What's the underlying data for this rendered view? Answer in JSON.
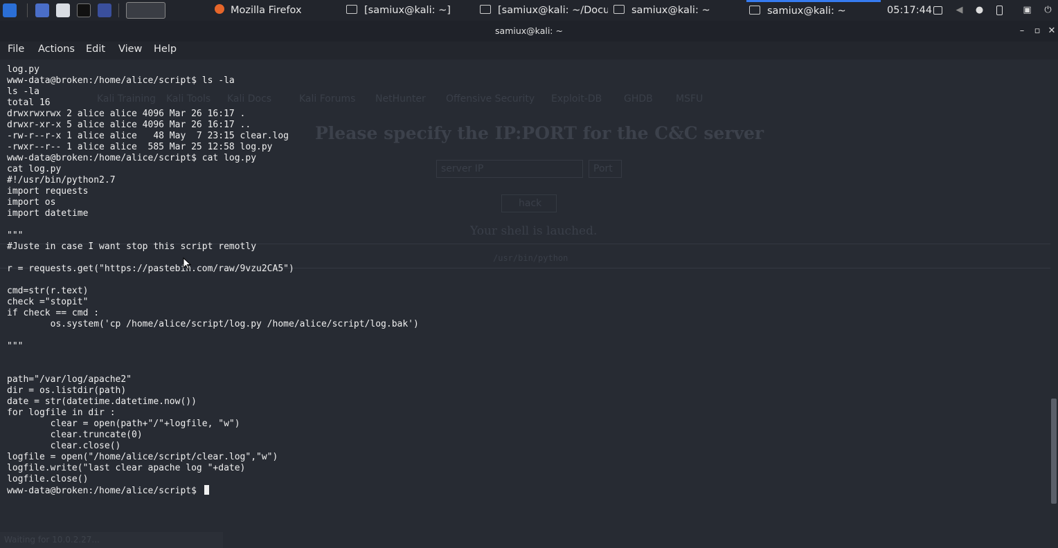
{
  "taskbar": {
    "tasks": [
      {
        "label": "Mozilla Firefox",
        "icon": "firefox-icon"
      },
      {
        "label": "[samiux@kali: ~]",
        "icon": "terminal-icon"
      },
      {
        "label": "[samiux@kali: ~/Docu...",
        "icon": "terminal-icon"
      },
      {
        "label": "samiux@kali: ~",
        "icon": "terminal-icon"
      },
      {
        "label": "samiux@kali: ~",
        "icon": "terminal-icon"
      }
    ],
    "clock": "05:17:44",
    "accent": "#367bf0"
  },
  "window": {
    "title": "samiux@kali: ~"
  },
  "menu": {
    "file": "File",
    "actions": "Actions",
    "edit": "Edit",
    "view": "View",
    "help": "Help"
  },
  "terminal": {
    "output": "log.py\nwww-data@broken:/home/alice/script$ ls -la\nls -la\ntotal 16\ndrwxrwxrwx 2 alice alice 4096 Mar 26 16:17 .\ndrwxr-xr-x 5 alice alice 4096 Mar 26 16:17 ..\n-rw-r--r-x 1 alice alice   48 May  7 23:15 clear.log\n-rwxr--r-- 1 alice alice  585 Mar 25 12:58 log.py\nwww-data@broken:/home/alice/script$ cat log.py\ncat log.py\n#!/usr/bin/python2.7\nimport requests\nimport os\nimport datetime\n\n\"\"\"\n#Juste in case I want stop this script remotly\n\nr = requests.get(\"https://pastebin.com/raw/9vzu2CA5\")\n\ncmd=str(r.text)\ncheck =\"stopit\"\nif check == cmd :\n        os.system('cp /home/alice/script/log.py /home/alice/script/log.bak')\n\n\"\"\"\n\n\npath=\"/var/log/apache2\"\ndir = os.listdir(path)\ndate = str(datetime.datetime.now())\nfor logfile in dir :\n        clear = open(path+\"/\"+logfile, \"w\")\n        clear.truncate(0)\n        clear.close()\nlogfile = open(\"/home/alice/script/clear.log\",\"w\")\nlogfile.write(\"last clear apache log \"+date)\nlogfile.close()\nwww-data@broken:/home/alice/script$ "
  },
  "background_window": {
    "heading": "Please specify the IP:PORT for the C&C server",
    "ip_placeholder": "server IP",
    "port_placeholder": "Port",
    "button": "hack",
    "message": "Your shell is lauched.",
    "path": "/usr/bin/python",
    "bookmarks": [
      "Kali Training",
      "Kali Tools",
      "Kali Docs",
      "Kali Forums",
      "NetHunter",
      "Offensive Security",
      "Exploit-DB",
      "GHDB",
      "MSFU"
    ],
    "status": "Waiting for 10.0.2.27..."
  }
}
